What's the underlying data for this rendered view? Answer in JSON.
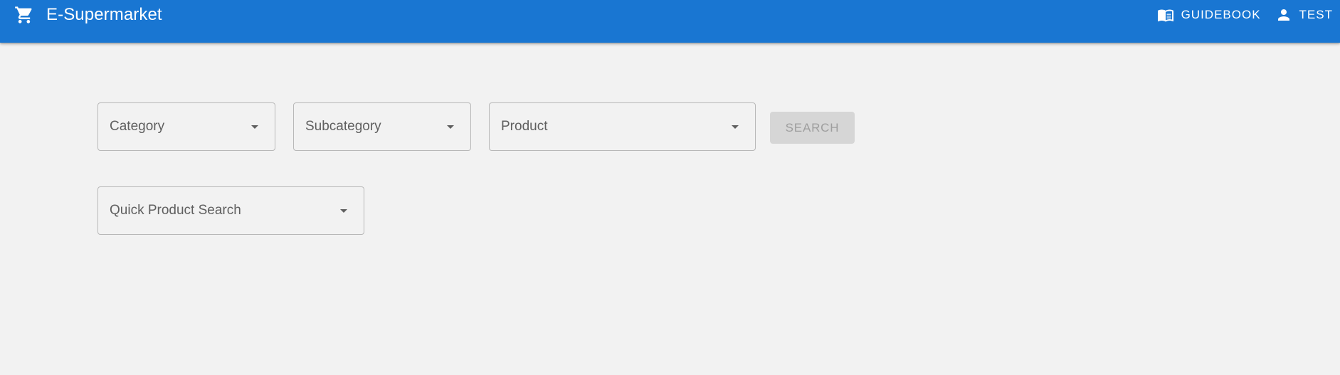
{
  "header": {
    "title": "E-Supermarket",
    "brand_icon": "shopping-cart-icon",
    "nav": [
      {
        "label": "GUIDEBOOK",
        "icon": "book-open-icon"
      },
      {
        "label": "TEST",
        "icon": "user-icon"
      }
    ]
  },
  "filters": {
    "category": {
      "placeholder": "Category"
    },
    "subcategory": {
      "placeholder": "Subcategory"
    },
    "product": {
      "placeholder": "Product"
    },
    "search_label": "SEARCH",
    "search_disabled": true
  },
  "quick_search": {
    "placeholder": "Quick Product Search"
  },
  "colors": {
    "primary": "#1976d2",
    "background": "#f2f2f2",
    "disabled_button": "#d6d6d6",
    "disabled_text": "#9e9e9e",
    "field_border": "#b8b8b8",
    "label_text": "#5f5f5f"
  }
}
